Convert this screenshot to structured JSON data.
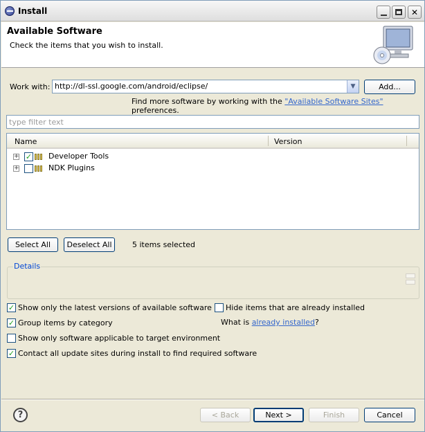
{
  "window": {
    "title": "Install"
  },
  "banner": {
    "title": "Available Software",
    "description": "Check the items that you wish to install."
  },
  "work_with": {
    "label": "Work with:",
    "value": "http://dl-ssl.google.com/android/eclipse/",
    "add_label": "Add...",
    "find_more_prefix": "Find more software by working with the ",
    "find_more_link": "\"Available Software Sites\"",
    "find_more_suffix": " preferences."
  },
  "filter": {
    "placeholder": "type filter text"
  },
  "tree": {
    "columns": [
      "Name",
      "Version"
    ],
    "rows": [
      {
        "label": "Developer Tools",
        "checked": true,
        "version": ""
      },
      {
        "label": "NDK Plugins",
        "checked": false,
        "version": ""
      }
    ]
  },
  "selection": {
    "select_all": "Select All",
    "deselect_all": "Deselect All",
    "count_text": "5 items selected"
  },
  "details": {
    "legend": "Details"
  },
  "options": {
    "latest_versions": {
      "label": "Show only the latest versions of available software",
      "checked": true
    },
    "hide_installed": {
      "label": "Hide items that are already installed",
      "checked": false
    },
    "group_by_category": {
      "label": "Group items by category",
      "checked": true
    },
    "what_is_prefix": "What is ",
    "what_is_link": "already installed",
    "what_is_suffix": "?",
    "target_env": {
      "label": "Show only software applicable to target environment",
      "checked": false
    },
    "contact_sites": {
      "label": "Contact all update sites during install to find required software",
      "checked": true
    }
  },
  "footer": {
    "back": "< Back",
    "next": "Next >",
    "finish": "Finish",
    "cancel": "Cancel"
  },
  "colors": {
    "link": "#3366cc",
    "legend": "#0046d5",
    "check": "#21a121"
  }
}
